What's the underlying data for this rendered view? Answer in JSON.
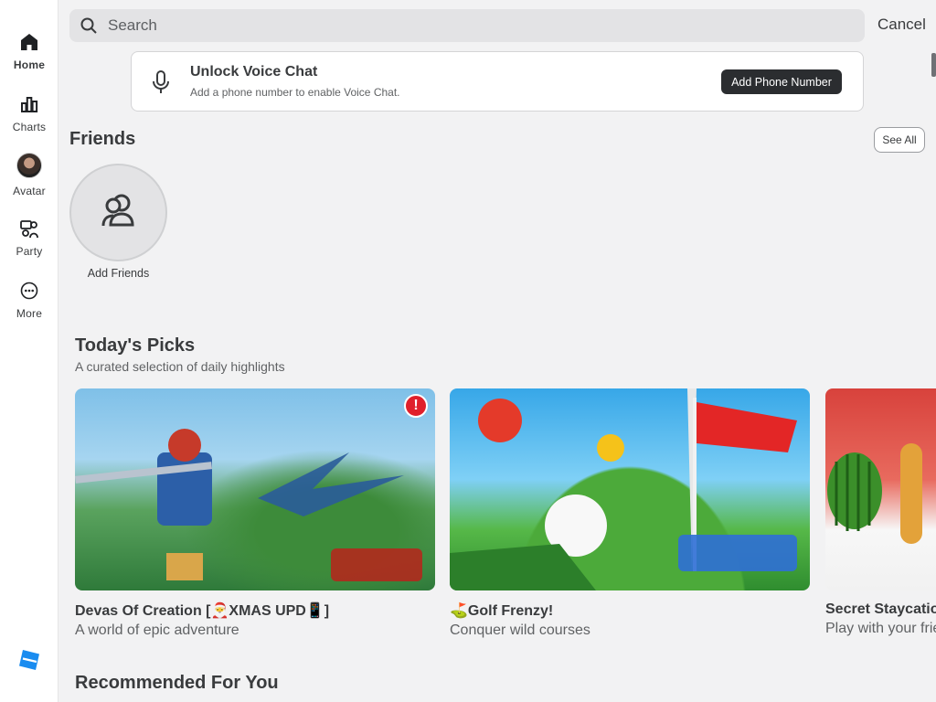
{
  "sidebar": {
    "items": [
      {
        "label": "Home",
        "icon": "home-icon"
      },
      {
        "label": "Charts",
        "icon": "charts-icon"
      },
      {
        "label": "Avatar",
        "icon": "avatar-icon"
      },
      {
        "label": "Party",
        "icon": "party-icon"
      },
      {
        "label": "More",
        "icon": "more-icon"
      }
    ],
    "active": "Home"
  },
  "search": {
    "placeholder": "Search",
    "value": "",
    "cancel_label": "Cancel"
  },
  "voice_banner": {
    "title": "Unlock Voice Chat",
    "subtitle": "Add a phone number to enable Voice Chat.",
    "button_label": "Add Phone Number"
  },
  "friends": {
    "title": "Friends",
    "see_all_label": "See All",
    "add_friends_label": "Add Friends"
  },
  "todays_picks": {
    "title": "Today's Picks",
    "subtitle": "A curated selection of daily highlights",
    "cards": [
      {
        "title": "Devas Of Creation [🎅XMAS UPD📱]",
        "subtitle": "A world of epic adventure",
        "badge": "!"
      },
      {
        "title": "⛳Golf Frenzy!",
        "subtitle": "Conquer wild courses"
      },
      {
        "title": "Secret Staycation",
        "subtitle": "Play with your friends"
      }
    ]
  },
  "recommended": {
    "title": "Recommended For You"
  },
  "colors": {
    "background": "#f2f2f3",
    "text": "#393b3d",
    "button_dark": "#2b2d30",
    "alert": "#e0202b",
    "logo": "#1a8cf0"
  }
}
